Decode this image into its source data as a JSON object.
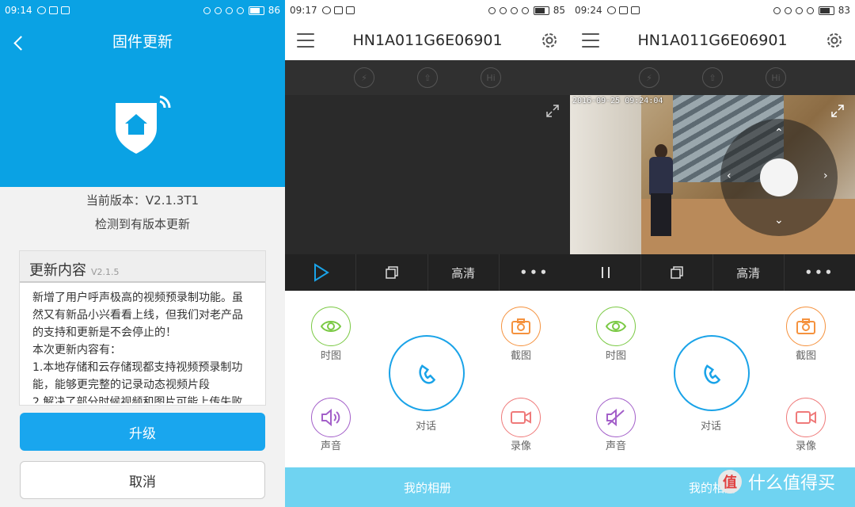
{
  "screens": [
    {
      "status": {
        "time": "09:14",
        "battery": "86"
      },
      "title": "固件更新",
      "current_version": "当前版本：V2.1.3T1",
      "detected": "检测到有版本更新",
      "update_title": "更新内容",
      "update_version": "V2.1.5",
      "update_text": "新增了用户呼声极高的视频预录制功能。虽然又有新品小兴看看上线，但我们对老产品的支持和更新是不会停止的！\n本次更新内容有：\n1.本地存储和云存储现都支持视频预录制功能，能够更完整的记录动态视频片段\n2.解决了部分时候视频和图片可能上传失败",
      "upgrade_label": "升级",
      "cancel_label": "取消"
    },
    {
      "status": {
        "time": "09:17",
        "battery": "85"
      },
      "title": "HN1A011G6E06901",
      "hd_label": "高清",
      "shortcuts": {
        "time_label": "时图",
        "capture_label": "截图",
        "sound_label": "声音",
        "record_label": "录像",
        "talk_label": "对话"
      },
      "album_label": "我的相册"
    },
    {
      "status": {
        "time": "09:24",
        "battery": "83"
      },
      "title": "HN1A011G6E06901",
      "timestamp": "2016-09-25 09:24:04",
      "hd_label": "高清",
      "shortcuts": {
        "time_label": "时图",
        "capture_label": "截图",
        "sound_label": "声音",
        "record_label": "录像",
        "talk_label": "对话"
      },
      "album_label": "我的相册"
    }
  ],
  "watermark": {
    "badge": "值",
    "text": "什么值得买"
  },
  "colors": {
    "accent": "#0aa2e4",
    "green": "#7ac943",
    "orange": "#f5923e",
    "purple": "#a35fc9",
    "pink": "#ef7a7a",
    "album": "#6fd3f1"
  }
}
